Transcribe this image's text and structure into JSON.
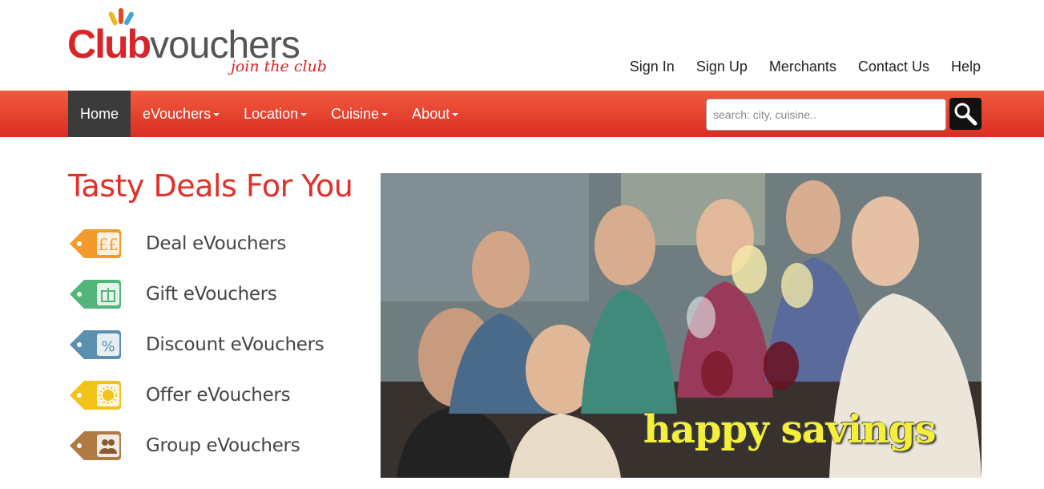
{
  "header": {
    "logo": {
      "brand_bold": "Club",
      "brand_light": "vouchers",
      "tagline": "join the club"
    },
    "top_links": [
      "Sign In",
      "Sign Up",
      "Merchants",
      "Contact Us",
      "Help"
    ]
  },
  "navbar": {
    "items": [
      {
        "label": "Home",
        "dropdown": false,
        "active": true
      },
      {
        "label": "eVouchers",
        "dropdown": true,
        "active": false
      },
      {
        "label": "Location",
        "dropdown": true,
        "active": false
      },
      {
        "label": "Cuisine",
        "dropdown": true,
        "active": false
      },
      {
        "label": "About",
        "dropdown": true,
        "active": false
      }
    ],
    "search": {
      "placeholder": "search: city, cuisine..",
      "icon": "magnifier-icon"
    }
  },
  "main": {
    "heading": "Tasty Deals For You",
    "deals": [
      {
        "label": "Deal eVouchers",
        "icon": "pound-tag-icon",
        "color": "#f39a2d"
      },
      {
        "label": "Gift eVouchers",
        "icon": "gift-tag-icon",
        "color": "#52b57a"
      },
      {
        "label": "Discount eVouchers",
        "icon": "percent-tag-icon",
        "color": "#5b8fb0"
      },
      {
        "label": "Offer eVouchers",
        "icon": "sun-tag-icon",
        "color": "#f2c31a"
      },
      {
        "label": "Group eVouchers",
        "icon": "people-tag-icon",
        "color": "#b07a45"
      }
    ],
    "hero": {
      "caption": "happy savings"
    }
  },
  "colors": {
    "brand_red": "#d9252a",
    "nav_top": "#f25a3e",
    "nav_bottom": "#d92e22",
    "nav_active": "#3b3b3b",
    "caption_yellow": "#f4ef3a"
  }
}
